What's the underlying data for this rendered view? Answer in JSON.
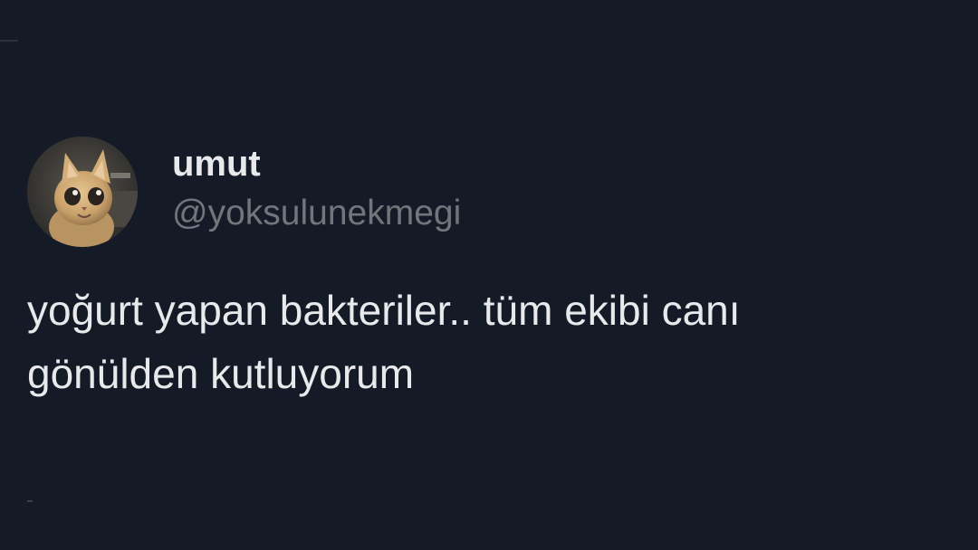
{
  "tweet": {
    "display_name": "umut",
    "handle": "@yoksulunekmegi",
    "text_line_1": "yoğurt yapan bakteriler.. tüm ekibi canı",
    "text_line_2": "gönülden kutluyorum",
    "avatar_icon": "cat-avatar-icon"
  },
  "colors": {
    "background": "#151b26",
    "name": "#e7e9ea",
    "handle": "#71767b",
    "text": "#e7e9ea"
  }
}
